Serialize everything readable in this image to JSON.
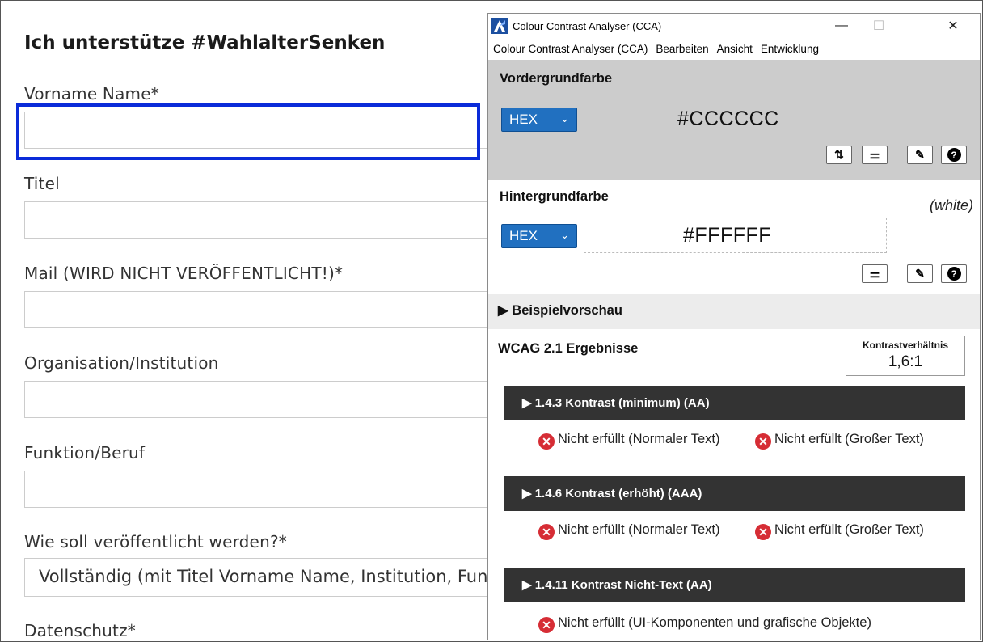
{
  "form": {
    "title": "Ich unterstütze #WahlalterSenken",
    "fields": [
      {
        "label": "Vorname Name*"
      },
      {
        "label": "Titel"
      },
      {
        "label": "Mail (WIRD NICHT VERÖFFENTLICHT!)*"
      },
      {
        "label": "Organisation/Institution"
      },
      {
        "label": "Funktion/Beruf"
      }
    ],
    "publish": {
      "label": "Wie soll veröffentlicht werden?*",
      "value": "Vollständig (mit Titel Vorname Name, Institution, Funktion)"
    },
    "privacy": {
      "label": "Datenschutz*"
    }
  },
  "cca": {
    "window_title": "Colour Contrast Analyser (CCA)",
    "menu": [
      "Colour Contrast Analyser (CCA)",
      "Bearbeiten",
      "Ansicht",
      "Entwicklung"
    ],
    "window_controls": {
      "minimize": "—",
      "maximize": "☐",
      "close": "✕"
    },
    "foreground": {
      "heading": "Vordergrundfarbe",
      "format": "HEX",
      "value": "#CCCCCC",
      "color": "#cccccc"
    },
    "background": {
      "heading": "Hintergrundfarbe",
      "name": "(white)",
      "format": "HEX",
      "value": "#FFFFFF",
      "color": "#ffffff"
    },
    "tools": {
      "swap": "⇅",
      "sliders": "⚌",
      "picker": "✎",
      "help": "?"
    },
    "preview": {
      "label": "Beispielvorschau"
    },
    "results": {
      "heading": "WCAG 2.1 Ergebnisse",
      "ratio_label": "Kontrastverhältnis",
      "ratio_value": "1,6:1",
      "criteria": [
        {
          "title": "1.4.3 Kontrast (minimum) (AA)",
          "normal": "Nicht erfüllt (Normaler Text)",
          "large": "Nicht erfüllt (Großer Text)"
        },
        {
          "title": "1.4.6 Kontrast (erhöht) (AAA)",
          "normal": "Nicht erfüllt (Normaler Text)",
          "large": "Nicht erfüllt (Großer Text)"
        },
        {
          "title": "1.4.11 Kontrast Nicht-Text (AA)",
          "ui": "Nicht erfüllt (UI-Komponenten und grafische Objekte)"
        }
      ]
    },
    "colors": {
      "fail": "#d62d35",
      "select": "#2170c0",
      "criterion_bar": "#333333"
    }
  }
}
